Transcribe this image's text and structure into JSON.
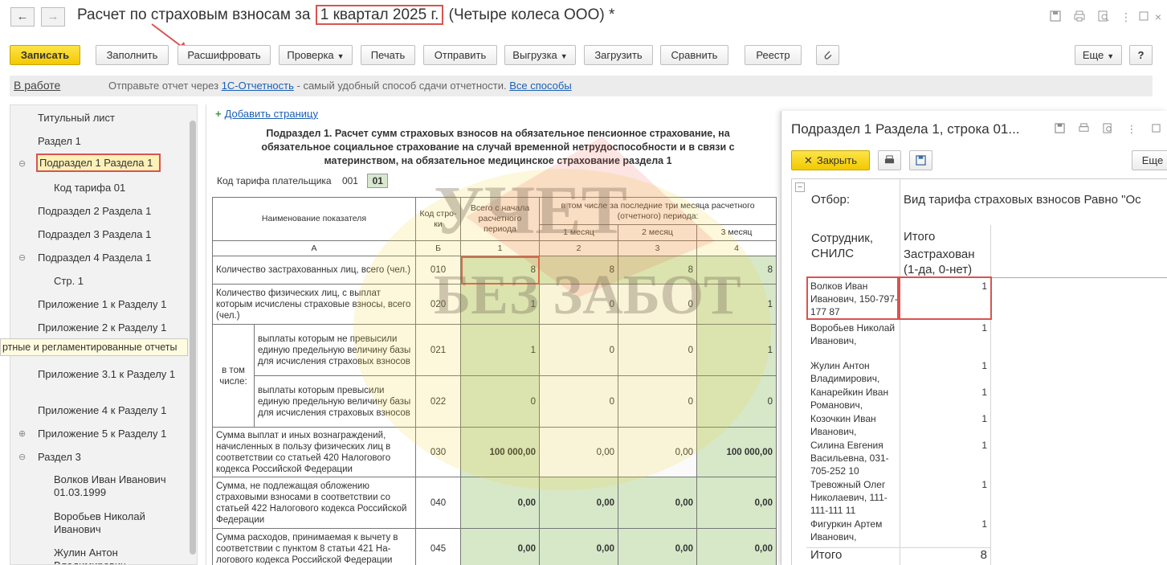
{
  "header": {
    "back_icon": "arrow-left-icon",
    "forward_icon": "arrow-right-icon",
    "title_prefix": "Расчет по страховым взносам за",
    "title_period": "1 квартал 2025 г.",
    "title_suffix": "(Четыре колеса ООО) *",
    "right_icons": [
      "save-icon",
      "print-icon",
      "preview-icon",
      "more-vertical-icon",
      "restore-icon",
      "close-icon"
    ]
  },
  "toolbar": {
    "save": "Записать",
    "fill": "Заполнить",
    "decode": "Расшифровать",
    "check": "Проверка",
    "print": "Печать",
    "send": "Отправить",
    "export": "Выгрузка",
    "import": "Загрузить",
    "compare": "Сравнить",
    "registry": "Реестр",
    "attach_icon": "paperclip-icon",
    "more": "Еще",
    "help": "?"
  },
  "infobar": {
    "status": "В работе",
    "msg_before": "Отправьте отчет через",
    "link1": "1С-Отчетность",
    "msg_after": "- самый удобный способ сдачи отчетности.",
    "link2": "Все способы"
  },
  "tree": {
    "items": [
      "Титульный лист",
      "Раздел 1",
      "Подраздел 1 Раздела 1",
      "Код тарифа 01",
      "Подраздел 2 Раздела 1",
      "Подраздел 3 Раздела 1",
      "Подраздел 4 Раздела 1",
      "Стр. 1",
      "Приложение 1 к Разделу 1",
      "Приложение 2 к Разделу 1",
      "Приложение 3.1 к Разделу 1",
      "Приложение 4 к Разделу 1",
      "Приложение 5 к Разделу 1",
      "Раздел 3",
      "Волков Иван Иванович 01.03.1999",
      "Воробьев Николай Иванович",
      "Жулин Антон Владимирович"
    ],
    "tooltip": "ртные и регламентированные отчеты"
  },
  "report": {
    "add_page": "Добавить страницу",
    "title": "Подраздел 1. Расчет сумм страховых взносов на обязательное пенсионное страхование, на обязательное социальное страхование на случай временной нетрудоспособности и в связи с материнством, на обязательное медицинское страхование раздела 1",
    "tarif_label": "Код тарифа плательщика",
    "tarif_code": "001",
    "tarif_value": "01",
    "headers": {
      "name": "Наименование показателя",
      "code": "Код стро-ки",
      "total": "Всего с начала расчетного периода",
      "last3": "в том числе за последние три месяца расчетного (отчетного) периода:",
      "m1": "1 месяц",
      "m2": "2 месяц",
      "m3": "3 месяц",
      "a": "А",
      "b": "Б",
      "n1": "1",
      "n2": "2",
      "n3": "3",
      "n4": "4"
    },
    "in_that": "в том числе:",
    "rows": [
      {
        "name": "Количество застрахованных лиц, всего (чел.)",
        "code": "010",
        "v": [
          "8",
          "8",
          "8",
          "8"
        ]
      },
      {
        "name": "Количество физических лиц, с выплат которым исчислены страховые взносы, всего (чел.)",
        "code": "020",
        "v": [
          "1",
          "0",
          "0",
          "1"
        ]
      },
      {
        "name": "выплаты которым не превысили единую предельную величину базы для исчисления страховых взносов",
        "code": "021",
        "v": [
          "1",
          "0",
          "0",
          "1"
        ]
      },
      {
        "name": "выплаты которым превысили единую предельную величину базы для исчисления страховых взносов",
        "code": "022",
        "v": [
          "0",
          "0",
          "0",
          "0"
        ]
      },
      {
        "name": "Сумма выплат и иных вознаграждений, начисленных в пользу физических лиц в соответствии со статьей 420 Налогового кодекса Российской Федерации",
        "code": "030",
        "v": [
          "100 000,00",
          "0,00",
          "0,00",
          "100 000,00"
        ]
      },
      {
        "name": "Сумма, не подлежащая обложению страховыми взносами в соответствии со статьей 422 Налогового кодекса Российской Федерации",
        "code": "040",
        "v": [
          "0,00",
          "0,00",
          "0,00",
          "0,00"
        ]
      },
      {
        "name": "Сумма расходов, принимаемая к вычету в соответствии с пунктом 8 статьи 421 На-логового кодекса Российской Федерации",
        "code": "045",
        "v": [
          "0,00",
          "0,00",
          "0,00",
          "0,00"
        ]
      }
    ]
  },
  "popup": {
    "title": "Подраздел 1 Раздела 1, строка 01...",
    "close": "Закрыть",
    "more": "Еще",
    "filter_label": "Отбор:",
    "filter_value": "Вид тарифа страховых взносов Равно \"Ос",
    "col1": "Сотрудник, СНИЛС",
    "col2_a": "Итого",
    "col2_b": "Застрахован (1-да, 0-нет)",
    "rows": [
      {
        "name": "Волков Иван Иванович, 150-797-177 87",
        "value": "1"
      },
      {
        "name": "Воробьев Николай Иванович,",
        "value": "1"
      },
      {
        "name": "Жулин Антон Владимирович,",
        "value": "1"
      },
      {
        "name": "Канарейкин Иван Романович,",
        "value": "1"
      },
      {
        "name": "Козочкин Иван Иванович,",
        "value": "1"
      },
      {
        "name": "Силина Евгения Васильевна, 031-705-252 10",
        "value": "1"
      },
      {
        "name": "Тревожный Олег Николаевич, 111-111-111 11",
        "value": "1"
      },
      {
        "name": "Фигуркин Артем Иванович,",
        "value": "1"
      }
    ],
    "total_label": "Итого",
    "total_value": "8"
  },
  "watermark": {
    "line1": "УЧЕТ",
    "line2": "БЕЗ ЗАБОТ"
  },
  "colors": {
    "accent_yellow": "#f2c900",
    "highlight_red": "#d9534f",
    "cell_green": "#d6e8c8",
    "link_blue": "#1a5fb4"
  }
}
